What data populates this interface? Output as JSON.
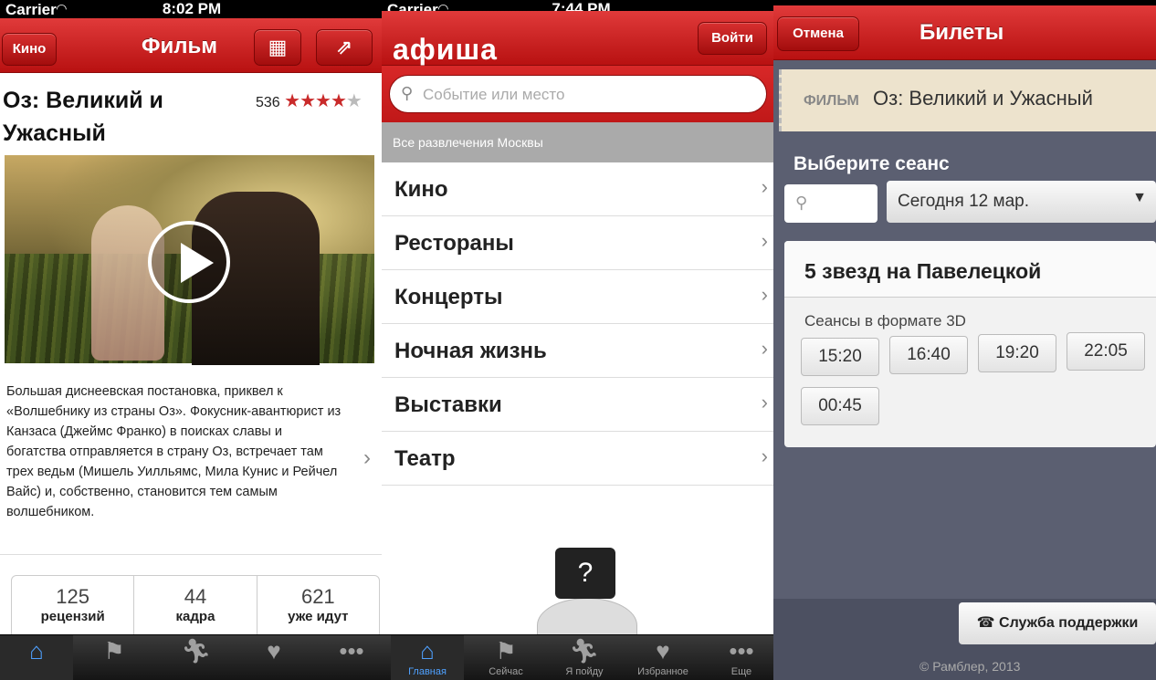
{
  "screen1": {
    "status": {
      "carrier": "Carrier",
      "time": "8:02 PM"
    },
    "nav": {
      "back_label": "Кино",
      "title": "Фильм"
    },
    "movie": {
      "title": "Оз: Великий и Ужасный",
      "rating_count": "536",
      "rating_stars": 4.5,
      "description": "Большая диснеевская постановка, приквел к «Волшебнику из страны Оз». Фокусник-авантюрист из Канзаса (Джеймс Франко) в поисках славы и богатства отправляется в страну Оз, встречает там трех ведьм (Мишель Уилльямс, Мила Кунис и Рейчел Вайс) и, собственно, становится тем самым волшебником."
    },
    "stats": [
      {
        "number": "125",
        "label": "рецензий"
      },
      {
        "number": "44",
        "label": "кадра"
      },
      {
        "number": "621",
        "label": "уже идут"
      }
    ]
  },
  "screen2": {
    "status": {
      "carrier": "Carrier",
      "time": "7:44 PM"
    },
    "nav": {
      "logo": "афиша",
      "login_label": "Войти"
    },
    "search": {
      "placeholder": "Событие или место"
    },
    "section_header": "Все развлечения Москвы",
    "categories": [
      "Кино",
      "Рестораны",
      "Концерты",
      "Ночная жизнь",
      "Выставки",
      "Театр"
    ],
    "help_label": "?",
    "tabs": [
      "Главная",
      "Сейчас",
      "Я пойду",
      "Избранное",
      "Еще"
    ]
  },
  "screen3": {
    "nav": {
      "cancel_label": "Отмена",
      "title": "Билеты"
    },
    "ticket": {
      "kind": "ФИЛЬМ",
      "name": "Оз: Великий и Ужасный"
    },
    "pick_label": "Выберите сеанс",
    "date_value": "Сегодня 12 мар.",
    "cinema": {
      "name": "5 звезд на Павелецкой",
      "format": "Сеансы в формате 3D",
      "times": [
        "15:20",
        "16:40",
        "19:20",
        "22:05",
        "00:45"
      ]
    },
    "support_label": "Служба поддержки",
    "copyright": "© Рамблер, 2013"
  },
  "colors": {
    "accent_red": "#c91818",
    "tab_active": "#4fa1ff",
    "panel_bg": "#5b5f71"
  }
}
